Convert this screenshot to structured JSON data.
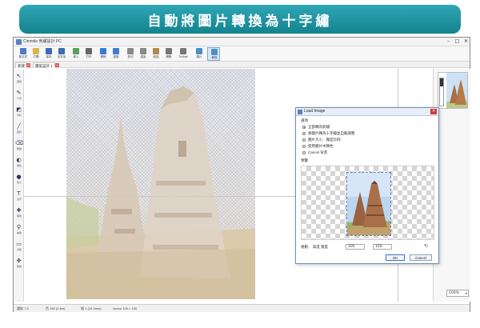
{
  "banner": {
    "title": "自動將圖片轉換為十字繡"
  },
  "window": {
    "title": "Cimmile 刺繡設計 PC",
    "minimize": "–",
    "maximize": "□",
    "close": "✕"
  },
  "toolbar": {
    "items": [
      {
        "label": "新文件",
        "icon": "new-file-icon",
        "color": "#4d7cc7"
      },
      {
        "label": "打開",
        "icon": "open-folder-icon",
        "color": "#e0b34a"
      },
      {
        "label": "保存",
        "icon": "save-icon",
        "color": "#3c6bb5"
      },
      {
        "label": "另存為",
        "icon": "save-as-icon",
        "color": "#3c6bb5"
      },
      {
        "label": "導入",
        "icon": "import-icon",
        "color": "#5aa05a"
      },
      {
        "label": "打印",
        "icon": "print-icon",
        "color": "#666666"
      },
      {
        "label": "撤銷",
        "icon": "undo-icon",
        "color": "#3a7bd5"
      },
      {
        "label": "重做",
        "icon": "redo-icon",
        "color": "#3a7bd5"
      },
      {
        "label": "剪切",
        "icon": "cut-icon",
        "color": "#888888"
      },
      {
        "label": "複製",
        "icon": "copy-icon",
        "color": "#888888"
      },
      {
        "label": "粘貼",
        "icon": "paste-icon",
        "color": "#b08a4e"
      },
      {
        "label": "網格",
        "icon": "grid-icon",
        "color": "#777777"
      },
      {
        "label": "Toolbar",
        "icon": "toolbar-icon",
        "color": "#777777"
      },
      {
        "label": "圖片",
        "icon": "image-icon",
        "color": "#4a90c8"
      },
      {
        "label": "轉換",
        "icon": "convert-icon",
        "color": "#4a90c8"
      }
    ]
  },
  "tabs": [
    {
      "label": "新建",
      "close": "×"
    },
    {
      "label": "圖案設計 1",
      "close": "×"
    }
  ],
  "left_tools": [
    {
      "icon": "select-icon",
      "glyph": "↖",
      "sub": "選擇"
    },
    {
      "icon": "pencil-icon",
      "glyph": "✎",
      "sub": "十字"
    },
    {
      "icon": "half-stitch-icon",
      "glyph": "◩",
      "sub": "半針"
    },
    {
      "icon": "backstitch-icon",
      "glyph": "╱",
      "sub": "回針"
    },
    {
      "icon": "eraser-icon",
      "glyph": "⌫",
      "sub": "刪除"
    },
    {
      "icon": "fill-icon",
      "glyph": "◐",
      "sub": "填充"
    },
    {
      "icon": "bead-icon",
      "glyph": "●",
      "sub": "珠子"
    },
    {
      "icon": "text-icon",
      "glyph": "T",
      "sub": "文字"
    },
    {
      "icon": "picker-icon",
      "glyph": "✚",
      "sub": "取色"
    },
    {
      "icon": "zoom-icon",
      "glyph": "⚲",
      "sub": "縮放"
    },
    {
      "icon": "rect-icon",
      "glyph": "▭",
      "sub": "方框"
    },
    {
      "icon": "move-icon",
      "glyph": "✥",
      "sub": "移動"
    }
  ],
  "dialog": {
    "title": "Load Image",
    "section_options": "選項",
    "options": [
      {
        "label": "全部轉為刺繡",
        "selected": true
      },
      {
        "label": "將圖片轉為十字繡並自動調整",
        "selected": false
      },
      {
        "label": "圖片大小、寬度比例",
        "selected": false
      },
      {
        "label": "使用圖片中顏色",
        "selected": false
      },
      {
        "label": "Cancel 背景",
        "selected": false
      }
    ],
    "section_preview": "預覽",
    "size_label": "格數：  高度 寬度",
    "size_w": "105",
    "size_h": "150",
    "ok": "OK",
    "cancel": "Cancel"
  },
  "palette": {
    "colors": [
      "#5b3a22",
      "#7a4e2c",
      "#8e6238",
      "#a6784a",
      "#b98d5d",
      "#c9a36f",
      "#d8b98a",
      "#6e6e6e",
      "#8c8c8c",
      "#a9a9a9",
      "#c5c5c5",
      "#6f8fb8",
      "#8aa6c8",
      "#a8bfd8",
      "#c9d8e8",
      "#d9c7a8",
      "#e6d7bd",
      "#b8a07a",
      "#9c8360",
      "#7d6a4f"
    ]
  },
  "zoom": "100%",
  "status": {
    "items": [
      "選取 7.5",
      "色 160 (0.6m)",
      "格 1 (23.3mm)",
      "cursor 105 × 150"
    ]
  }
}
